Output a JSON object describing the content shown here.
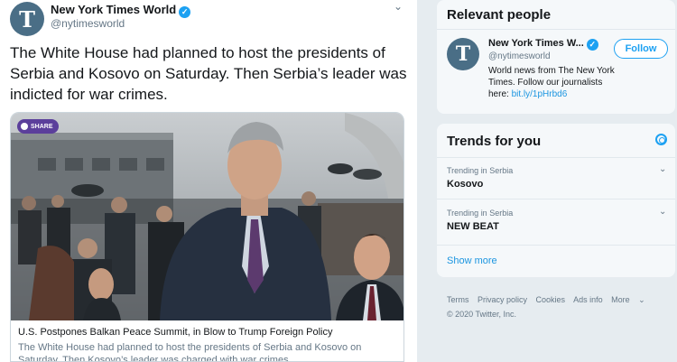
{
  "tweet": {
    "avatar_letter": "T",
    "name": "New York Times World",
    "handle": "@nytimesworld",
    "text": "The White House had planned to host the presidents of Serbia and Kosovo on Saturday. Then Serbia’s leader was indicted for war crimes.",
    "card": {
      "share_label": "SHARE",
      "title": "U.S. Postpones Balkan Peace Summit, in Blow to Trump Foreign Policy",
      "description": "The White House had planned to host the presidents of Serbia and Kosovo on Saturday. Then Kosovo’s leader was charged with war crimes."
    }
  },
  "relevant": {
    "heading": "Relevant people",
    "person": {
      "avatar_letter": "T",
      "name": "New York Times W...",
      "handle": "@nytimesworld",
      "bio": "World news from The New York Times. Follow our journalists here:",
      "link": "bit.ly/1pHrbd6",
      "follow_label": "Follow"
    }
  },
  "trends": {
    "heading": "Trends for you",
    "items": [
      {
        "context": "Trending in Serbia",
        "name": "Kosovo"
      },
      {
        "context": "Trending in Serbia",
        "name": "NEW BEAT"
      }
    ],
    "show_more": "Show more"
  },
  "footer": {
    "links": [
      "Terms",
      "Privacy policy",
      "Cookies",
      "Ads info",
      "More"
    ],
    "copyright": "© 2020 Twitter, Inc."
  },
  "colors": {
    "accent": "#1da1f2",
    "link": "#1b95e0",
    "muted": "#657786",
    "panel_bg": "#f5f8fa"
  }
}
